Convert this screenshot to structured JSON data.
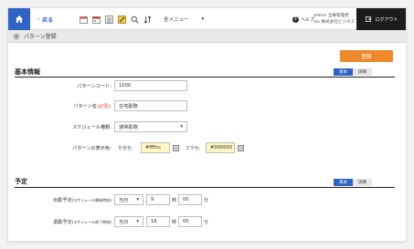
{
  "toolbar": {
    "back_label": "戻る",
    "all_menu_label": "全メニュー",
    "help_label": "ヘルプ",
    "user_line1": "admin 全権管理者",
    "user_line2": "ats 株式会社ビジネス",
    "logout_label": "ログアウト"
  },
  "page": {
    "title": "パターン登録"
  },
  "actions": {
    "register_label": "登録"
  },
  "basic": {
    "title": "基本情報",
    "toggle_basic": "基本",
    "toggle_detail": "詳細",
    "code_label": "パターンコード:",
    "code_value": "1000",
    "name_label": "パターン名",
    "name_required": "(必須)",
    "name_suffix": ":",
    "name_value": "在宅勤務",
    "schedule_label": "スケジュール種類:",
    "schedule_value": "通常勤務",
    "color_label": "パターンの表示色:",
    "bg_label": "背景色:",
    "bg_value": "#ffffcc",
    "text_color_label": "文字色:",
    "text_color_value": "#000000"
  },
  "schedule": {
    "title": "予定",
    "toggle_basic": "基本",
    "toggle_detail": "詳細",
    "start_label": "出勤予定",
    "start_note": "(スケジュール開始時刻):",
    "start_day": "当日",
    "start_hour": "9",
    "start_minute": "00",
    "end_label": "退勤予定",
    "end_note": "(スケジュール終了時刻):",
    "end_day": "当日",
    "end_hour": "18",
    "end_minute": "00",
    "hour_unit": "時",
    "minute_unit": "分"
  },
  "colors": {
    "accent": "#2f64c5",
    "button": "#ef8a2b",
    "highlight": "#fff7c2"
  }
}
